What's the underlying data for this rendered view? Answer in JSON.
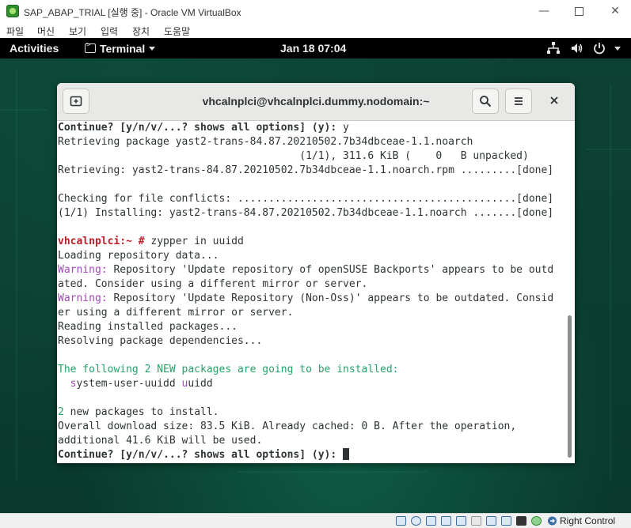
{
  "vbox": {
    "title": "SAP_ABAP_TRIAL [실행 중] - Oracle VM VirtualBox",
    "menu": [
      "파일",
      "머신",
      "보기",
      "입력",
      "장치",
      "도움말"
    ],
    "host_key": "Right Control"
  },
  "gnome": {
    "activities": "Activities",
    "app_menu": "Terminal",
    "clock": "Jan 18  07:04"
  },
  "terminal": {
    "title": "vhcalnplci@vhcalnplci.dummy.nodomain:~",
    "lines": {
      "l1_bold": "Continue? [y/n/v/...? shows all options] (y):",
      "l1_answer": " y",
      "l2": "Retrieving package yast2-trans-84.87.20210502.7b34dbceae-1.1.noarch",
      "l3": "                                       (1/1), 311.6 KiB (    0   B unpacked)",
      "l4": "Retrieving: yast2-trans-84.87.20210502.7b34dbceae-1.1.noarch.rpm .........[done]",
      "l5": "",
      "l6": "Checking for file conflicts: .............................................[done]",
      "l7": "(1/1) Installing: yast2-trans-84.87.20210502.7b34dbceae-1.1.noarch .......[done]",
      "l8": "",
      "l9_prompt": "vhcalnplci:~ #",
      "l9_cmd": " zypper in uuidd",
      "l10": "Loading repository data...",
      "l11_warn": "Warning:",
      "l11_rest": " Repository 'Update repository of openSUSE Backports' appears to be outd",
      "l12": "ated. Consider using a different mirror or server.",
      "l13_warn": "Warning:",
      "l13_rest": " Repository 'Update Repository (Non-Oss)' appears to be outdated. Consid",
      "l14": "er using a different mirror or server.",
      "l15": "Reading installed packages...",
      "l16": "Resolving package dependencies...",
      "l17": "",
      "l18": "The following 2 NEW packages are going to be installed:",
      "l19_indent": "  ",
      "l19_s": "s",
      "l19_rest1": "ystem-user-uuidd ",
      "l19_u": "u",
      "l19_rest2": "uidd",
      "l20": "",
      "l21_num": "2",
      "l21_rest": " new packages to install.",
      "l22": "Overall download size: 83.5 KiB. Already cached: 0 B. After the operation,",
      "l23": "additional 41.6 KiB will be used.",
      "l24_bold": "Continue? [y/n/v/...? shows all options] (y):",
      "l24_space": " "
    }
  },
  "icons": {
    "vbox_logo": "virtualbox-logo-icon",
    "topbar": [
      "network-icon",
      "volume-icon",
      "power-icon"
    ],
    "header": [
      "new-tab-icon",
      "search-icon",
      "hamburger-menu-icon",
      "close-icon"
    ],
    "statusbar": [
      "hard-disk-icon",
      "optical-drive-icon",
      "audio-icon",
      "network-adapter-icon",
      "usb-icon",
      "shared-folders-icon",
      "display-icon",
      "video-capture-icon",
      "cpu-icon",
      "recording-icon",
      "mouse-integration-icon",
      "keyboard-icon",
      "host-key-arrow-icon"
    ]
  }
}
